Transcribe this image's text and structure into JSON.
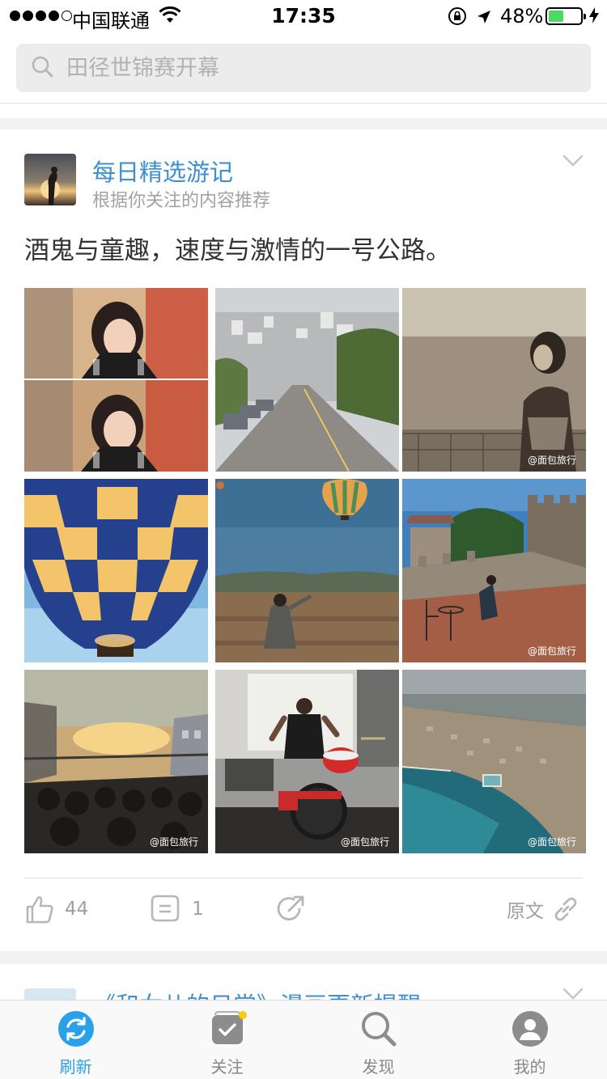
{
  "status_bar": {
    "carrier": "中国联通",
    "time": "17:35",
    "battery_percent": "48%",
    "battery_level": 0.48,
    "signal_bars": 4,
    "signal_total": 5
  },
  "search": {
    "placeholder": "田径世锦赛开幕"
  },
  "feed": {
    "card": {
      "title": "每日精选游记",
      "subtitle": "根据你关注的内容推荐",
      "text": "酒鬼与童趣，速度与激情的一号公路。",
      "photos": [
        {
          "icon": "photo-woman-dessert",
          "watermark": ""
        },
        {
          "icon": "photo-steep-street",
          "watermark": ""
        },
        {
          "icon": "photo-woman-by-sea",
          "watermark": "@面包旅行"
        },
        {
          "icon": "photo-hot-air-balloon",
          "watermark": ""
        },
        {
          "icon": "photo-woman-field-balloon",
          "watermark": ""
        },
        {
          "icon": "photo-castle-terrace",
          "watermark": "@面包旅行"
        },
        {
          "icon": "photo-bus-sunset",
          "watermark": "@面包旅行"
        },
        {
          "icon": "photo-street-drummer",
          "watermark": "@面包旅行"
        },
        {
          "icon": "photo-aerial-coast",
          "watermark": "@面包旅行"
        }
      ],
      "actions": {
        "like_count": "44",
        "comment_count": "1",
        "source_label": "原文"
      }
    },
    "next_card": {
      "title": "《和女儿的日常》漫画更新提醒"
    }
  },
  "tabbar": {
    "tabs": [
      {
        "label": "刷新",
        "icon": "refresh-icon",
        "active": true
      },
      {
        "label": "关注",
        "icon": "follow-icon",
        "active": false,
        "badge_dot": true
      },
      {
        "label": "发现",
        "icon": "discover-icon",
        "active": false
      },
      {
        "label": "我的",
        "icon": "profile-icon",
        "active": false
      }
    ]
  },
  "colors": {
    "accent": "#2aa0e8",
    "link_title": "#3d8fd1",
    "badge_dot": "#ffcc00",
    "battery_fill": "#4cd964"
  }
}
